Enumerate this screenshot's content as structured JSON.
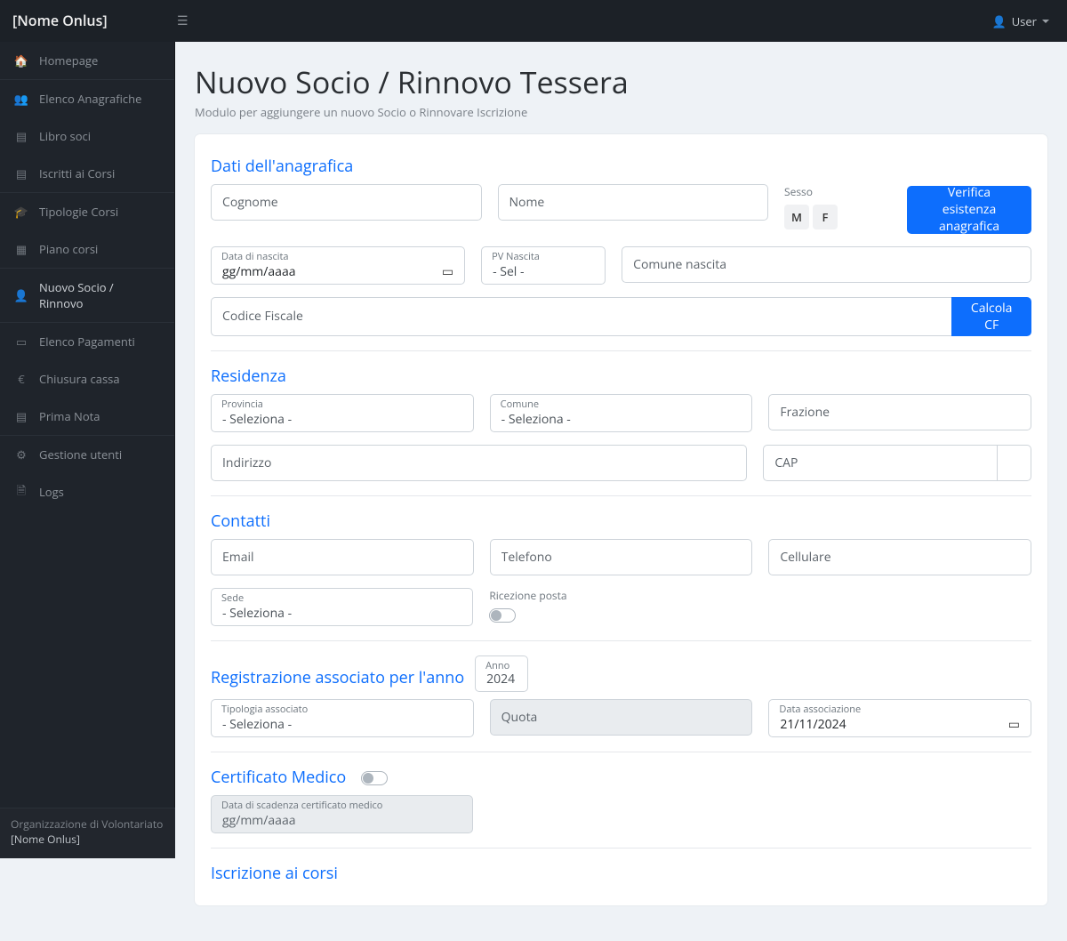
{
  "brand": "[Nome Onlus]",
  "user_label": "User",
  "page": {
    "title": "Nuovo Socio / Rinnovo Tessera",
    "subtitle": "Modulo per aggiungere un nuovo Socio o Rinnovare Iscrizione"
  },
  "sidebar": {
    "items": [
      {
        "icon": "home",
        "label": "Homepage"
      },
      {
        "sep": true
      },
      {
        "icon": "users",
        "label": "Elenco Anagrafiche"
      },
      {
        "icon": "book",
        "label": "Libro soci"
      },
      {
        "icon": "list",
        "label": "Iscritti ai Corsi"
      },
      {
        "sep": true
      },
      {
        "icon": "grad",
        "label": "Tipologie Corsi"
      },
      {
        "icon": "calendar",
        "label": "Piano corsi"
      },
      {
        "sep": true
      },
      {
        "icon": "userplus",
        "label": "Nuovo Socio / Rinnovo"
      },
      {
        "sep": true
      },
      {
        "icon": "card",
        "label": "Elenco Pagamenti"
      },
      {
        "icon": "euro",
        "label": "Chiusura cassa"
      },
      {
        "icon": "note",
        "label": "Prima Nota"
      },
      {
        "sep": true
      },
      {
        "icon": "gear",
        "label": "Gestione utenti"
      },
      {
        "icon": "file",
        "label": "Logs"
      }
    ],
    "footer_line1": "Organizzazione di Volontariato",
    "footer_line2": "[Nome Onlus]"
  },
  "sections": {
    "anagrafica": "Dati dell'anagrafica",
    "residenza": "Residenza",
    "contatti": "Contatti",
    "registrazione": "Registrazione associato per l'anno",
    "certificato": "Certificato Medico",
    "iscrizione": "Iscrizione ai corsi"
  },
  "labels": {
    "cognome_ph": "Cognome",
    "nome_ph": "Nome",
    "sesso": "Sesso",
    "sesso_M": "M",
    "sesso_F": "F",
    "verify_btn": "Verifica esistenza anagrafica",
    "data_nascita": "Data di nascita",
    "date_ph": "gg/mm/aaaa",
    "pv_nascita": "PV Nascita",
    "pv_nascita_sel": "- Sel -",
    "comune_nascita_ph": "Comune nascita",
    "cf_ph": "Codice Fiscale",
    "calc_cf": "Calcola CF",
    "provincia": "Provincia",
    "seleziona": "- Seleziona -",
    "comune": "Comune",
    "frazione_ph": "Frazione",
    "indirizzo_ph": "Indirizzo",
    "cap_ph": "CAP",
    "email_ph": "Email",
    "telefono_ph": "Telefono",
    "cellulare_ph": "Cellulare",
    "sede": "Sede",
    "ricezione_posta": "Ricezione posta",
    "anno": "Anno",
    "anno_val": "2024",
    "tipologia_assoc": "Tipologia associato",
    "quota_ph": "Quota",
    "data_assoc": "Data associazione",
    "data_assoc_val": "21/11/2024",
    "data_scad_cert": "Data di scadenza certificato medico"
  }
}
